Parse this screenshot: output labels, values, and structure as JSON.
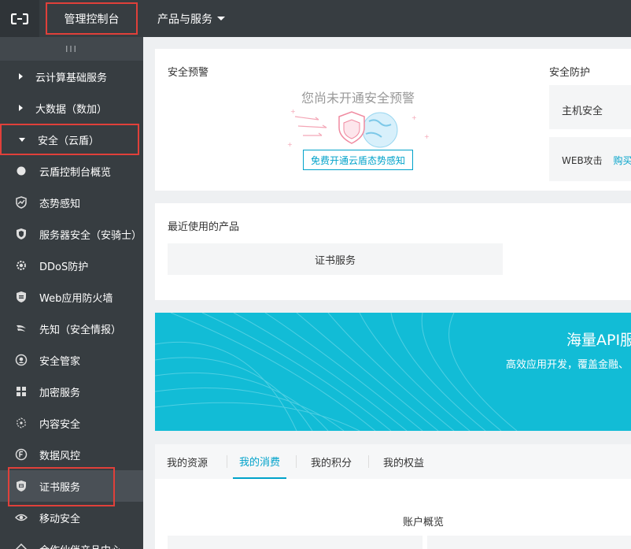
{
  "topbar": {
    "console_label": "管理控制台",
    "products_label": "产品与服务"
  },
  "sidebar": {
    "toggle": "III",
    "categories": [
      {
        "label": "云计算基础服务"
      },
      {
        "label": "大数据（数加）"
      },
      {
        "label": "安全（云盾）"
      }
    ],
    "items": [
      {
        "label": "云盾控制台概览",
        "icon": "dot-icon"
      },
      {
        "label": "态势感知",
        "icon": "trend-shield-icon"
      },
      {
        "label": "服务器安全（安骑士）",
        "icon": "shield-icon"
      },
      {
        "label": "DDoS防护",
        "icon": "gear-icon"
      },
      {
        "label": "Web应用防火墙",
        "icon": "firewall-icon"
      },
      {
        "label": "先知（安全情报）",
        "icon": "wing-icon"
      },
      {
        "label": "安全管家",
        "icon": "butler-icon"
      },
      {
        "label": "加密服务",
        "icon": "puzzle-icon"
      },
      {
        "label": "内容安全",
        "icon": "nodes-icon"
      },
      {
        "label": "数据风控",
        "icon": "data-risk-icon"
      },
      {
        "label": "证书服务",
        "icon": "certificate-icon"
      },
      {
        "label": "移动安全",
        "icon": "mobile-security-icon"
      },
      {
        "label": "合作伙伴产品中心",
        "icon": "partner-icon"
      }
    ]
  },
  "alert_card": {
    "title": "安全预警",
    "empty_text": "您尚未开通安全预警",
    "button_label": "免费开通云盾态势感知"
  },
  "protection": {
    "title": "安全防护",
    "host_label": "主机安全",
    "web_label": "WEB攻击",
    "buy_label": "购买"
  },
  "recent": {
    "title": "最近使用的产品",
    "product": "证书服务"
  },
  "banner": {
    "title": "海量API服",
    "subtitle": "高效应用开发，覆盖金融、",
    "bg_color": "#12bcd6"
  },
  "tabs": [
    {
      "label": "我的资源"
    },
    {
      "label": "我的消费"
    },
    {
      "label": "我的积分"
    },
    {
      "label": "我的权益"
    }
  ],
  "account": {
    "title": "账户概览"
  }
}
